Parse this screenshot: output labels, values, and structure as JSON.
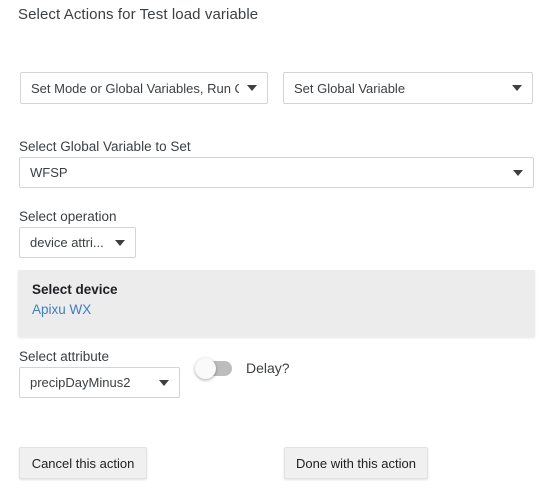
{
  "page_title": "Select Actions for Test load variable",
  "action_row": {
    "type_select": {
      "value": "Set Mode or Global Variables, Run C...",
      "caret_icon": "chevron-down-icon"
    },
    "kind_select": {
      "value": "Set Global Variable",
      "caret_icon": "chevron-down-icon"
    }
  },
  "global_variable": {
    "label": "Select Global Variable to Set",
    "value": "WFSP",
    "caret_icon": "chevron-down-icon"
  },
  "operation": {
    "label": "Select operation",
    "value": "device attri...",
    "caret_icon": "chevron-down-icon"
  },
  "device": {
    "title": "Select device",
    "name": "Apixu WX",
    "link_color": "#3f7fbf",
    "panel_color": "#ececec"
  },
  "attribute": {
    "label": "Select attribute",
    "value": "precipDayMinus2",
    "caret_icon": "chevron-down-icon"
  },
  "delay": {
    "label": "Delay?",
    "state": "off"
  },
  "buttons": {
    "cancel": "Cancel this action",
    "done": "Done with this action"
  }
}
